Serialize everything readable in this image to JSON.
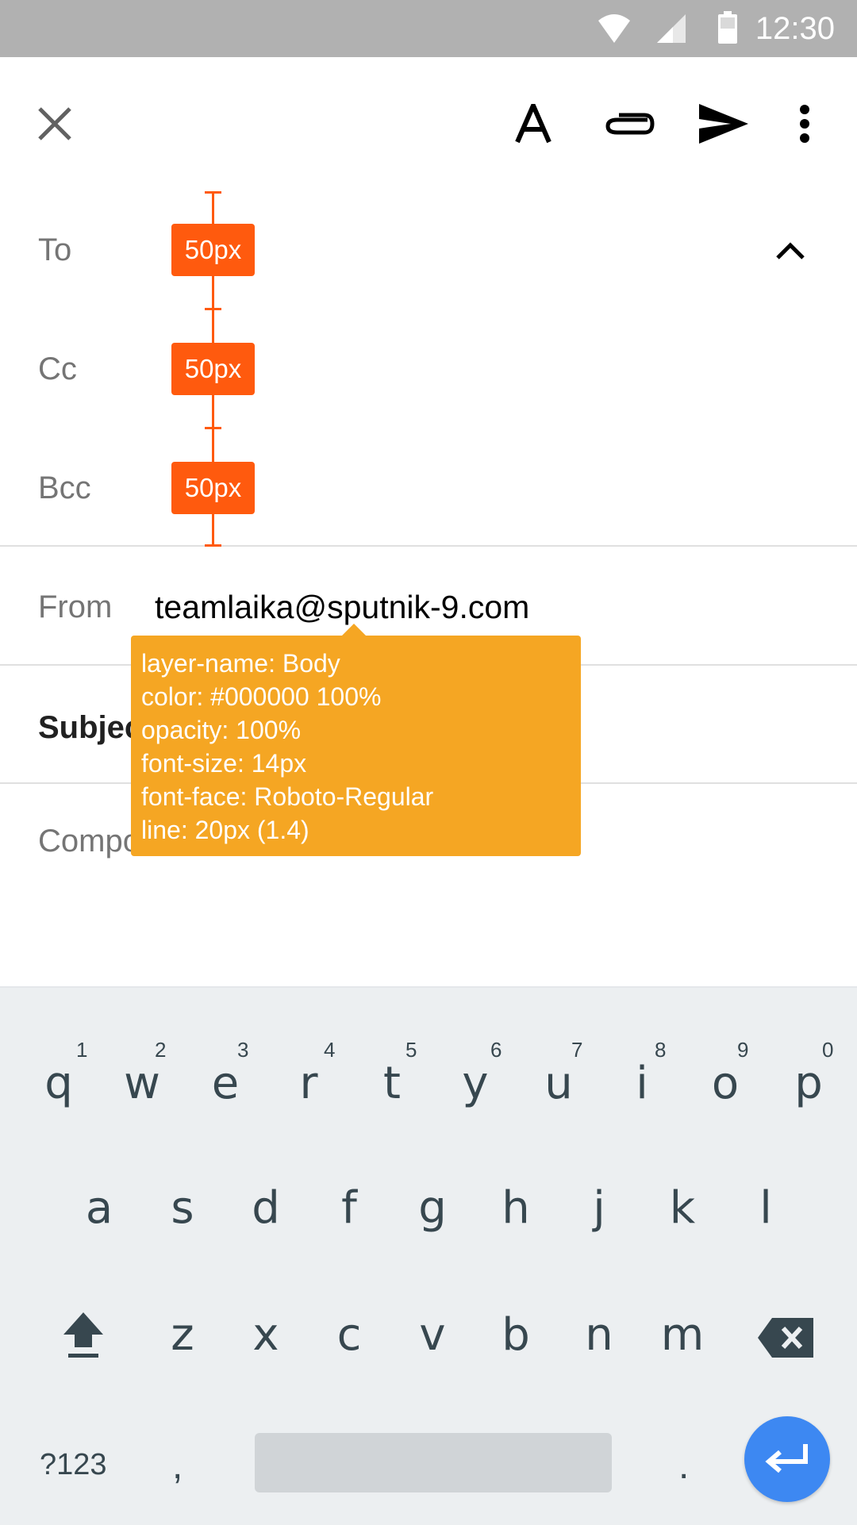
{
  "status_bar": {
    "time": "12:30",
    "icons": [
      "wifi-icon",
      "cell-signal-icon",
      "battery-icon"
    ]
  },
  "toolbar": {
    "icons": [
      "close-icon",
      "format-text-icon",
      "attach-icon",
      "send-icon",
      "more-vert-icon"
    ]
  },
  "fields": {
    "to_label": "To",
    "cc_label": "Cc",
    "bcc_label": "Bcc",
    "from_label": "From",
    "from_value": "teamlaika@sputnik-9.com",
    "subject_label": "Subjec",
    "compose_label": "Compo"
  },
  "measurements": [
    "50px",
    "50px",
    "50px"
  ],
  "tooltip": {
    "line1": "layer-name: Body",
    "line2": "color: #000000 100%",
    "line3": "opacity: 100%",
    "line4": "font-size: 14px",
    "line5": "font-face: Roboto-Regular",
    "line6": "line: 20px (1.4)"
  },
  "keyboard": {
    "row1": [
      "q",
      "w",
      "e",
      "r",
      "t",
      "y",
      "u",
      "i",
      "o",
      "p"
    ],
    "row1_hints": [
      "1",
      "2",
      "3",
      "4",
      "5",
      "6",
      "7",
      "8",
      "9",
      "0"
    ],
    "row2": [
      "a",
      "s",
      "d",
      "f",
      "g",
      "h",
      "j",
      "k",
      "l"
    ],
    "row3": [
      "z",
      "x",
      "c",
      "v",
      "b",
      "n",
      "m"
    ],
    "symbols_key": "?123",
    "comma_key": ",",
    "period_key": "."
  },
  "colors": {
    "status_bar": "#b1b1b1",
    "measure": "#ff5a0e",
    "tooltip": "#f5a623",
    "keyboard_bg": "#eceff1",
    "enter_key": "#3d88f2"
  }
}
